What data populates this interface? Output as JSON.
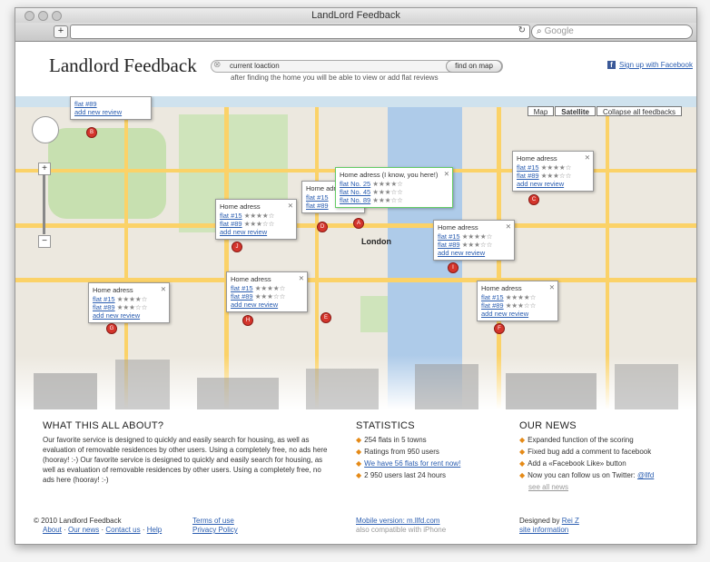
{
  "window": {
    "title": "LandLord Feedback"
  },
  "browser": {
    "search_placeholder": "Google"
  },
  "header": {
    "logo": "Landlord Feedback",
    "search_value": "current loaction",
    "find_button": "find on map",
    "hint": "after finding the home you will be able to view or add flat reviews",
    "facebook": "Sign up with Facebook"
  },
  "map": {
    "modes": [
      "Map",
      "Satellite",
      "Collapse all feedbacks"
    ],
    "city_label": "London",
    "popups": [
      {
        "title": "",
        "flats": [
          "flat #89"
        ],
        "add": "add new review"
      },
      {
        "title": "Home adress",
        "flats": [
          "flat #15",
          "flat #89"
        ],
        "add": "add new review"
      },
      {
        "title": "Home adress",
        "flats": [
          "flat #15",
          "flat #89"
        ],
        "add": "add new review"
      },
      {
        "title": "Home adress (I know, you here!)",
        "flats": [
          "flat No. 25",
          "flat No. 45",
          "flat No. 89"
        ],
        "add": "add new review"
      },
      {
        "title": "Home adress",
        "flats": [
          "flat #15",
          "flat #89"
        ],
        "add": "add new review"
      },
      {
        "title": "Home adress",
        "flats": [
          "flat #15",
          "flat #89"
        ],
        "add": "add new review"
      },
      {
        "title": "Home adress",
        "flats": [
          "flat #15",
          "flat #89"
        ],
        "add": "add new review"
      },
      {
        "title": "Home adress",
        "flats": [
          "flat #15",
          "flat #89"
        ],
        "add": "add new review"
      },
      {
        "title": "Home adress",
        "flats": [
          "flat #15",
          "flat #89"
        ],
        "add": "add new review"
      }
    ],
    "pins": [
      "B",
      "C",
      "D",
      "J",
      "A",
      "I",
      "H",
      "E",
      "F",
      "G"
    ]
  },
  "about": {
    "title": "WHAT THIS ALL ABOUT?",
    "text": "Our favorite service is designed to quickly and easily search for housing, as well as evaluation of removable residences by other users. Using a completely free, no ads here (hooray! :-) Our favorite service is designed to quickly and easily search for housing, as well as evaluation of removable residences by other users. Using a completely free, no ads here (hooray! :-)"
  },
  "stats": {
    "title": "STATISTICS",
    "items": [
      "254 flats in 5 towns",
      "Ratings from 950 users",
      "We have 56 flats for rent now!",
      "2 950 users last 24 hours"
    ]
  },
  "news": {
    "title": "OUR NEWS",
    "items": [
      "Expanded function of the scoring",
      "Fixed bug add a comment to facebook",
      "Add a «Facebook Like» button",
      "Now you can follow us on Twitter:",
      "@llfd"
    ],
    "see_all": "see all news"
  },
  "footer": {
    "copyright": "© 2010 Landlord Feedback",
    "links": [
      "About",
      "Our news",
      "Contact us",
      "Help"
    ],
    "terms": "Terms of use",
    "privacy": "Privacy Policy",
    "mobile": "Mobile version: m.llfd.com",
    "compat": "also compatible with iPhone",
    "designed": "Designed by",
    "designer": "Rei Z",
    "site_info": "site information"
  }
}
